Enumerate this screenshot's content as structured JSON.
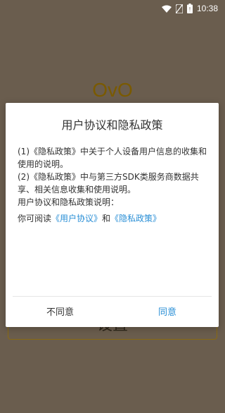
{
  "status_bar": {
    "time": "10:38",
    "icons": [
      "wifi-icon",
      "no-sim-icon",
      "battery-icon"
    ]
  },
  "app": {
    "title": "OvO",
    "bottom_button": "设置"
  },
  "dialog": {
    "title": "用户协议和隐私政策",
    "para1": "(1)《隐私政策》中关于个人设备用户信息的收集和使用的说明。",
    "para2": "(2)《隐私政策》中与第三方SDK类服务商数据共享、相关信息收集和使用说明。",
    "para3": "用户协议和隐私政策说明：",
    "read_prefix": "你可阅读",
    "link_user_agreement": "《用户协议》",
    "read_and": "和",
    "link_privacy_policy": "《隐私政策》",
    "disagree_label": "不同意",
    "agree_label": "同意"
  },
  "colors": {
    "link": "#2a8fd6",
    "background_overlay": "#6a5d4e"
  }
}
